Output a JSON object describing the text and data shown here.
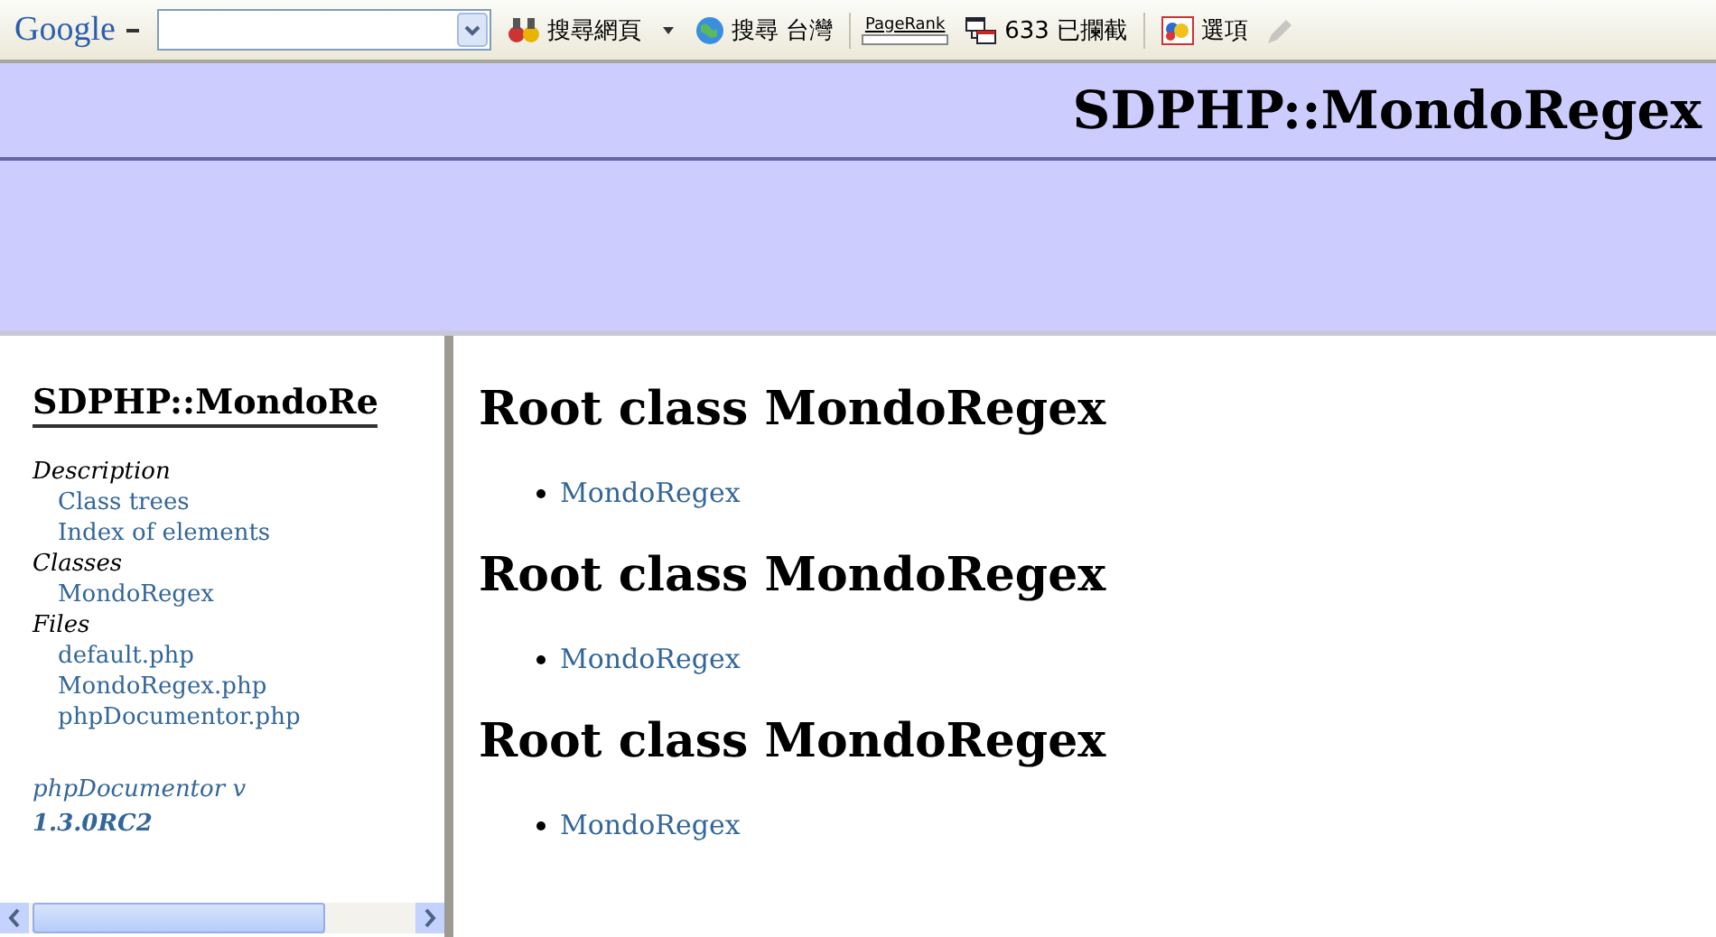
{
  "toolbar": {
    "logo": "Google",
    "items": [
      {
        "kind": "search-web",
        "label": "搜尋網頁"
      },
      {
        "kind": "search-site",
        "label": "搜尋 台灣"
      },
      {
        "kind": "pagerank",
        "label": "PageRank"
      },
      {
        "kind": "popups",
        "label": "633 已攔截"
      },
      {
        "kind": "options",
        "label": "選項"
      },
      {
        "kind": "highlight",
        "disabled": true
      }
    ]
  },
  "header": {
    "title": "SDPHP::MondoRegex"
  },
  "sidebar": {
    "title": "SDPHP::MondoRe",
    "items": [
      {
        "kind": "heading",
        "label": "Description"
      },
      {
        "kind": "link",
        "label": "Class trees"
      },
      {
        "kind": "link",
        "label": "Index of elements"
      },
      {
        "kind": "heading",
        "label": "Classes"
      },
      {
        "kind": "link",
        "label": "MondoRegex"
      },
      {
        "kind": "heading",
        "label": "Files"
      },
      {
        "kind": "link",
        "label": "default.php"
      },
      {
        "kind": "link",
        "label": "MondoRegex.php"
      },
      {
        "kind": "link",
        "label": "phpDocumentor.php"
      }
    ],
    "footer": {
      "label": "phpDocumentor v",
      "version": "1.3.0RC2"
    }
  },
  "content": {
    "sections": [
      {
        "heading": "Root class MondoRegex",
        "links": [
          "MondoRegex"
        ]
      },
      {
        "heading": "Root class MondoRegex",
        "links": [
          "MondoRegex"
        ]
      },
      {
        "heading": "Root class MondoRegex",
        "links": [
          "MondoRegex"
        ]
      }
    ]
  }
}
